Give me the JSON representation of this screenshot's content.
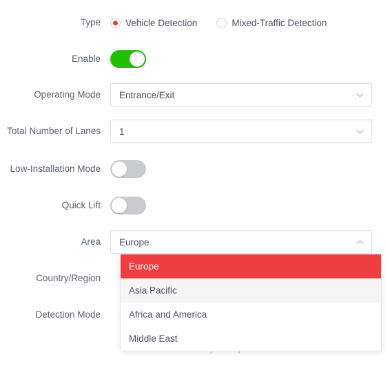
{
  "form": {
    "rows": [
      {
        "label": "Type",
        "kind": "radio"
      },
      {
        "label": "Enable",
        "kind": "toggle"
      },
      {
        "label": "Operating Mode",
        "kind": "select"
      },
      {
        "label": "Total Number of Lanes",
        "kind": "select"
      },
      {
        "label": "Low-Installation Mode",
        "kind": "toggle"
      },
      {
        "label": "Quick Lift",
        "kind": "toggle"
      },
      {
        "label": "Area",
        "kind": "select"
      },
      {
        "label": "Country/Region",
        "kind": "select"
      },
      {
        "label": "Detection Mode",
        "kind": "select"
      }
    ],
    "type": {
      "label": "Type",
      "options": [
        {
          "label": "Vehicle Detection",
          "selected": true
        },
        {
          "label": "Mixed-Traffic Detection",
          "selected": false
        }
      ]
    },
    "enable": {
      "label": "Enable",
      "state": "on"
    },
    "operating_mode": {
      "label": "Operating Mode",
      "value": "Entrance/Exit",
      "chevron": "chevron-down-icon"
    },
    "total_lanes": {
      "label": "Total Number of Lanes",
      "value": "1",
      "chevron": "chevron-down-icon"
    },
    "low_installation_mode": {
      "label": "Low-Installation Mode",
      "state": "off"
    },
    "quick_lift": {
      "label": "Quick Lift",
      "state": "off"
    },
    "area": {
      "label": "Area",
      "value": "Europe",
      "chevron": "chevron-up-icon",
      "expanded": true,
      "options": [
        {
          "label": "Europe",
          "state": "selected"
        },
        {
          "label": "Asia Pacific",
          "state": "hover"
        },
        {
          "label": "Africa and America",
          "state": "normal"
        },
        {
          "label": "Middle East",
          "state": "normal"
        }
      ]
    },
    "country_region": {
      "label": "Country/Region"
    },
    "detection_mode": {
      "label": "Detection Mode"
    },
    "hint": {
      "line2": "information and the captured pictures."
    }
  },
  "colors": {
    "accent_red": "#ef3e42",
    "toggle_on_green": "#1ec000",
    "toggle_off_gray": "#c9cbcf",
    "border": "#dcdfe6",
    "text": "#4c5263",
    "label_text": "#596172",
    "hint_text": "#b9bcc3",
    "hover_bg": "#f5f5f5"
  }
}
